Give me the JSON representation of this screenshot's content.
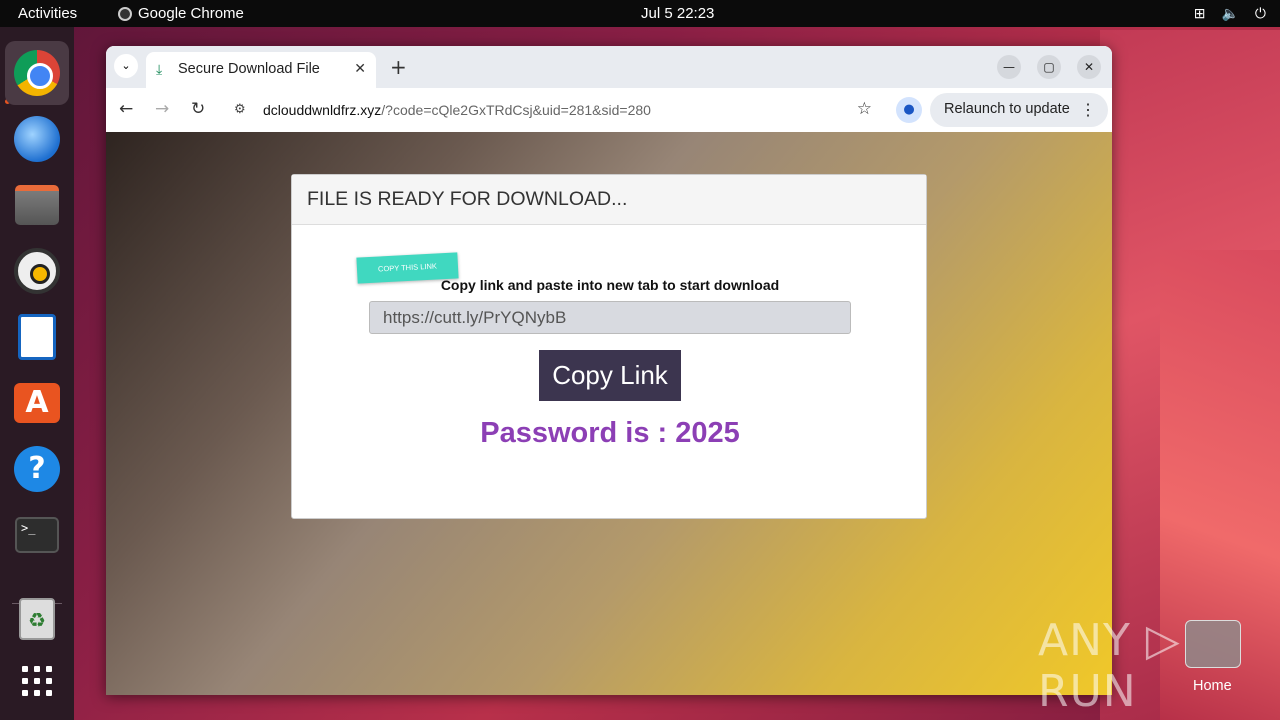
{
  "topbar": {
    "activities": "Activities",
    "app_name": "Google Chrome",
    "clock": "Jul 5  22:23",
    "tray": [
      "network-icon",
      "volume-icon",
      "power-icon"
    ]
  },
  "dock": {
    "items": [
      "chrome-icon",
      "thunderbird-icon",
      "files-icon",
      "rhythmbox-icon",
      "libreoffice-writer-icon",
      "app-center-icon",
      "help-icon",
      "terminal-icon",
      "trash-icon",
      "show-apps-icon"
    ],
    "terminal_prompt": ">_"
  },
  "browser": {
    "tab_title": "Secure Download File",
    "tab_close": "✕",
    "new_tab": "+",
    "url_host": "dclouddwnldfrz.xyz",
    "url_rest": "/?code=cQle2GxTRdCsj&uid=281&sid=280",
    "relaunch_label": "Relaunch to update",
    "window_controls": [
      "minimize",
      "maximize",
      "close"
    ]
  },
  "page": {
    "header": "FILE IS READY FOR DOWNLOAD...",
    "ribbon": "COPY THIS LINK",
    "instruction": "Copy link and paste into new tab to start download",
    "link_value": "https://cutt.ly/PrYQNybB",
    "copy_button": "Copy Link",
    "password_text": "Password is : 2025",
    "password_color": "#8c3fb5",
    "button_color": "#3c354f"
  },
  "desktop": {
    "watermark": "ANY ▷ RUN",
    "home_label": "Home"
  }
}
